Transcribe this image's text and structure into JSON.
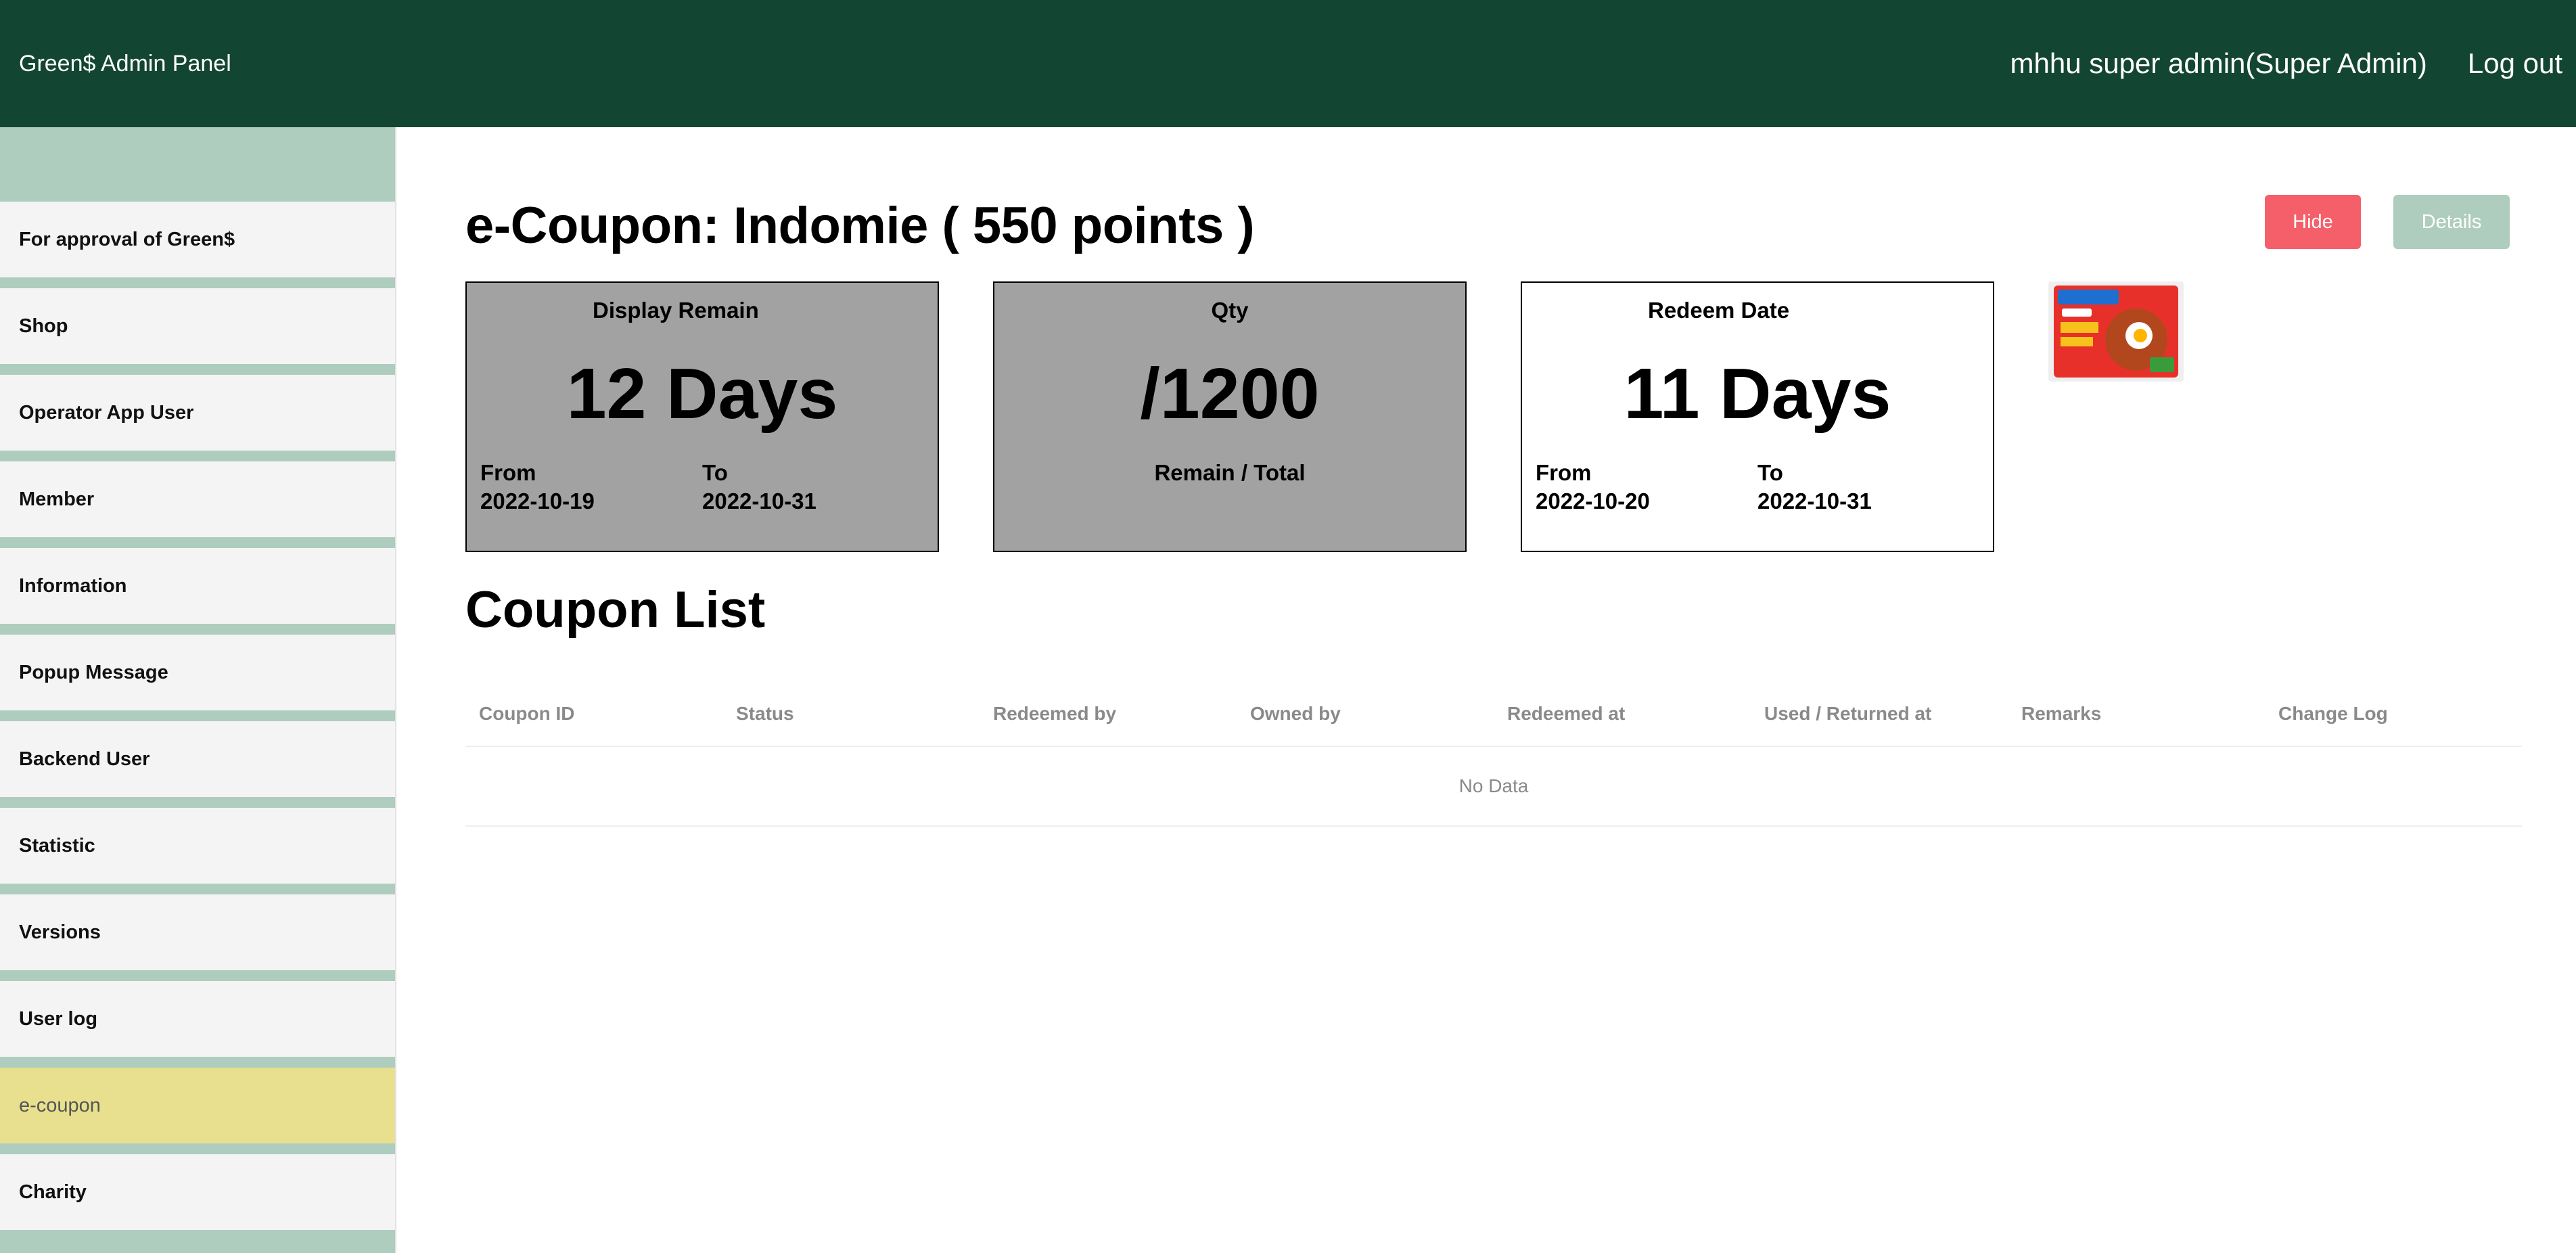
{
  "header": {
    "brand": "Green$ Admin Panel",
    "user": "mhhu super admin(Super Admin)",
    "logout": "Log out"
  },
  "sidebar": {
    "items": [
      {
        "label": "For approval of Green$"
      },
      {
        "label": "Shop"
      },
      {
        "label": "Operator App User"
      },
      {
        "label": "Member"
      },
      {
        "label": "Information"
      },
      {
        "label": "Popup Message"
      },
      {
        "label": "Backend User"
      },
      {
        "label": "Statistic"
      },
      {
        "label": "Versions"
      },
      {
        "label": "User log"
      },
      {
        "label": "e-coupon"
      },
      {
        "label": "Charity"
      }
    ],
    "active": "e-coupon"
  },
  "page": {
    "title": "e-Coupon: Indomie ( 550 points )",
    "hide_label": "Hide",
    "details_label": "Details"
  },
  "cards": {
    "display": {
      "title": "Display Remain",
      "value": "12 Days",
      "from_label": "From",
      "from": "2022-10-19",
      "to_label": "To",
      "to": "2022-10-31"
    },
    "qty": {
      "title": "Qty",
      "value": "/1200",
      "sub": "Remain / Total"
    },
    "redeem": {
      "title": "Redeem Date",
      "value": "11 Days",
      "from_label": "From",
      "from": "2022-10-20",
      "to_label": "To",
      "to": "2022-10-31"
    }
  },
  "coupon_list": {
    "title": "Coupon List",
    "columns": [
      "Coupon ID",
      "Status",
      "Redeemed by",
      "Owned by",
      "Redeemed at",
      "Used / Returned at",
      "Remarks",
      "Change Log"
    ],
    "empty": "No Data"
  },
  "colors": {
    "header_bg": "#134632",
    "sidebar_bg": "#aecdbf",
    "active_item": "#e8e08e",
    "hide_button": "#f55f69",
    "details_button": "#aecdbf"
  }
}
